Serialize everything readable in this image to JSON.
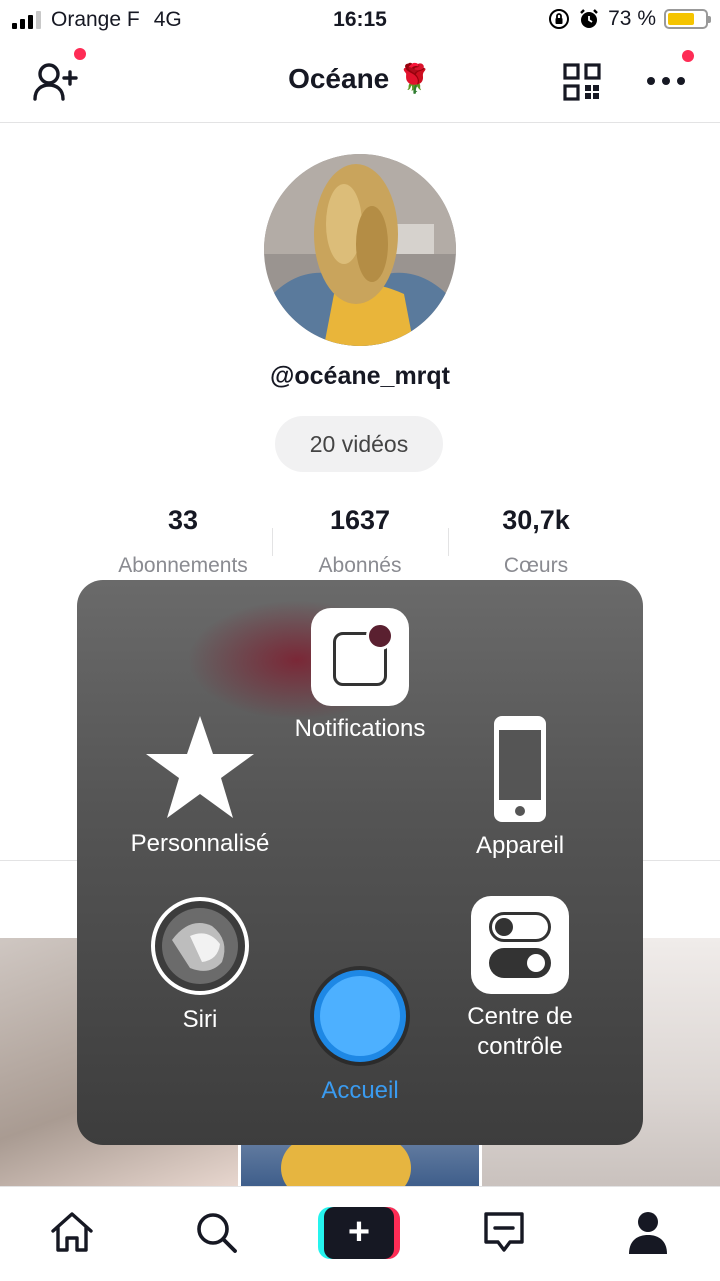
{
  "status_bar": {
    "carrier": "Orange F",
    "network": "4G",
    "time": "16:15",
    "battery_percent": "73 %",
    "battery_level": 0.73,
    "signal_bars": 3
  },
  "header": {
    "title": "Océane 🌹",
    "icons": [
      "add-friend-icon",
      "qr-code-icon",
      "more-icon"
    ]
  },
  "profile": {
    "username": "@océane_mrqt",
    "videos_label": "20 vidéos",
    "stats": [
      {
        "value": "33",
        "label": "Abonnements"
      },
      {
        "value": "1637",
        "label": "Abonnés"
      },
      {
        "value": "30,7k",
        "label": "Cœurs"
      }
    ]
  },
  "assistive_menu": {
    "notifications": "Notifications",
    "custom": "Personnalisé",
    "device": "Appareil",
    "siri": "Siri",
    "home": "Accueil",
    "control_center": "Centre de\ncontrôle"
  },
  "tabbar": {
    "icons": [
      "home-icon",
      "search-icon",
      "create-icon",
      "inbox-icon",
      "profile-icon"
    ],
    "create_label": "+"
  },
  "colors": {
    "accent_red": "#fe2c55",
    "accent_cyan": "#25f4ee",
    "home_blue": "#4db0ff",
    "label_blue": "#3a9bf0"
  }
}
